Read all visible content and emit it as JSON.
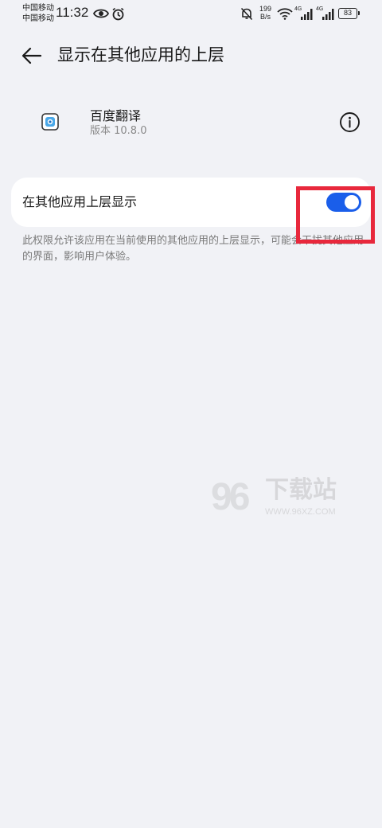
{
  "status_bar": {
    "carrier_1": "中国移动",
    "carrier_2": "中国移动",
    "time": "11:32",
    "net_speed_value": "199",
    "net_speed_unit": "B/s",
    "network_1": "4G",
    "network_2": "4G",
    "battery_level": "83",
    "icons": [
      "eye-icon",
      "alarm-icon",
      "bell-muted-icon",
      "wifi-icon",
      "signal-icon",
      "signal-icon",
      "battery-icon"
    ]
  },
  "header": {
    "title": "显示在其他应用的上层",
    "back_icon": "arrow-left-icon"
  },
  "app": {
    "name": "百度翻译",
    "version": "版本 10.8.0",
    "info_icon": "info-icon"
  },
  "setting": {
    "label": "在其他应用上层显示",
    "enabled": true,
    "description": "此权限允许该应用在当前使用的其他应用的上层显示，可能会干扰其他应用的界面，影响用户体验。"
  },
  "watermark": {
    "number": "96",
    "text": "下载站",
    "url": "WWW.96XZ.COM"
  },
  "colors": {
    "accent": "#1a5eea",
    "background": "#f1f2f6",
    "card": "#ffffff",
    "annotation": "#e8283c"
  }
}
